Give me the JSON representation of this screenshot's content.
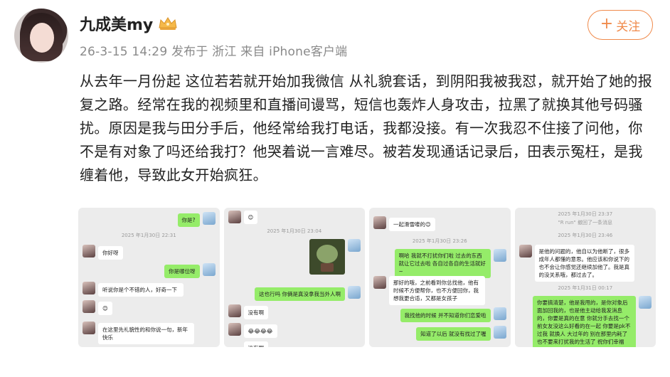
{
  "user": {
    "name": "九成美my",
    "badge_icon": "crown-icon",
    "meta": "26-3-15 14:29  发布于 浙江  来自 iPhone客户端"
  },
  "follow": {
    "plus": "+",
    "label": "关注"
  },
  "post": {
    "text": "从去年一月份起 这位若若就开始加我微信 从礼貌套话，到阴阳我被我怼，就开始了她的报复之路。经常在我的视频里和直播间谩骂，短信也轰炸人身攻击，拉黑了就换其他号码骚扰。原因是我与田分手后，他经常给我打电话，我都没接。有一次我忍不住接了问他，你不是有对象了吗还给我打？他哭着说一言难尽。被若发现通话记录后，田表示冤枉，是我缠着他，导致此女开始疯狂。"
  },
  "screenshots": [
    {
      "messages": [
        {
          "side": "right",
          "text": "你是?"
        },
        {
          "side": "time",
          "text": "2025 年1月30日 22:31"
        },
        {
          "side": "left",
          "text": "你好呀"
        },
        {
          "side": "right",
          "text": "你是哪位呀"
        },
        {
          "side": "left",
          "text": "听说你是个不错的人，好奇一下"
        },
        {
          "side": "left",
          "text": "😊"
        },
        {
          "side": "left",
          "text": "在这里先礼貌性的和你说一句，新年快乐"
        }
      ]
    },
    {
      "messages": [
        {
          "side": "left",
          "text": "😊"
        },
        {
          "side": "time",
          "text": "2025 年1月30日 23:04"
        },
        {
          "side": "right",
          "text": "这也行吗 你俩是真没拿我当外人啊"
        },
        {
          "side": "left",
          "text": "没有啊"
        },
        {
          "side": "left",
          "text": "😂😂😂😂"
        },
        {
          "side": "left",
          "text": "没有啊"
        }
      ]
    },
    {
      "messages": [
        {
          "side": "left",
          "text": "一起滑雪喽的😊"
        },
        {
          "side": "time",
          "text": "2025 年1月30日 23:26"
        },
        {
          "side": "right",
          "text": "啊哈 我就不打扰你们啦 过去的东西就让它过去啦 各自过各自的生活就好~"
        },
        {
          "side": "left",
          "text": "那好的哦，之前看到你总找他，他有时候不方便帮你，也不方便回你，我想我更合适，又都是女孩子"
        },
        {
          "side": "right",
          "text": "我找他的时候 并不知道你们恋爱啦"
        },
        {
          "side": "right",
          "text": "知道了以后 就没有找过了喔"
        }
      ]
    },
    {
      "messages": [
        {
          "side": "time",
          "text": "2025 年1月30日 23:37"
        },
        {
          "side": "time",
          "text": "\"R run\" 撤回了一条消息"
        },
        {
          "side": "time",
          "text": "2025 年1月30日 23:46"
        },
        {
          "side": "left",
          "text": "是他的问题的，他自以为他断了，很多成年人都懂的意思。他应该和你说下的 也不会让你感觉还继续加他了。我是真的没关系哦，都过去了。"
        },
        {
          "side": "time",
          "text": "2025 年1月31日 00:17"
        },
        {
          "side": "right",
          "text": "你要搞清楚，他是我甩的，是你对象后面加回我的，也是他主动给我发消息的，你要是真的在意 你就分手去找一个前女友没这么好看的在一起 你要是pk不过我 就换人 大过年的 别在那里内耗了 也不要来打扰我的生活了 祝你们幸福"
        }
      ]
    }
  ]
}
